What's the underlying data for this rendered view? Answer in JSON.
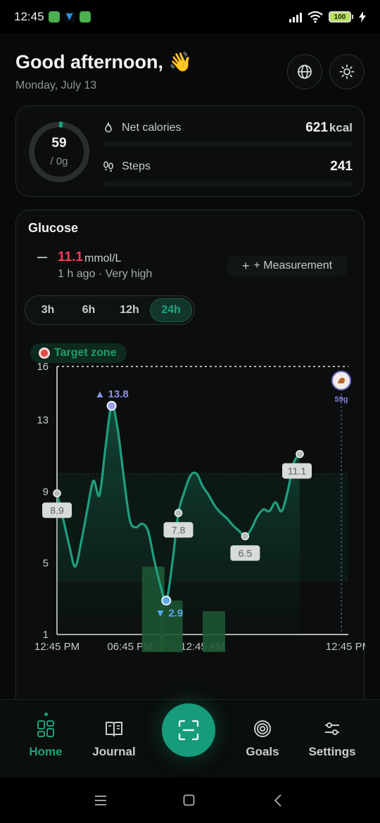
{
  "status_bar": {
    "time": "12:45",
    "battery": "100"
  },
  "header": {
    "greeting": "Good afternoon, 👋",
    "date": "Monday, July 13"
  },
  "summary": {
    "ring_value": "59",
    "ring_goal": "/ 0g",
    "net_calories_label": "Net calories",
    "net_calories_value": "621",
    "net_calories_unit": "kcal",
    "steps_label": "Steps",
    "steps_value": "241"
  },
  "glucose": {
    "title": "Glucose",
    "current_value": "11.1",
    "unit": "mmol/L",
    "subtitle": "1 h ago · Very high",
    "measurement_button": "+ Measurement",
    "ranges": [
      "3h",
      "6h",
      "12h",
      "24h"
    ],
    "active_range": "24h",
    "target_zone_label": "Target zone",
    "meal_label": "59g",
    "colors": {
      "line": "#1f9e7e",
      "high": "#ff3b5c",
      "accent": "#17a27e"
    }
  },
  "chart_data": {
    "type": "line",
    "y_ticks": [
      "16",
      "13",
      "9",
      "5",
      "1"
    ],
    "ylim": [
      1,
      16
    ],
    "x_ticks": [
      "12:45 PM",
      "06:45 PM",
      "12:45 AM",
      "12:45 PM"
    ],
    "xlim_hours": [
      0,
      24
    ],
    "series": [
      {
        "x_hours": [
          0,
          0.5,
          1,
          1.5,
          2,
          2.5,
          3,
          3.5,
          4,
          4.5,
          5,
          5.5,
          6,
          6.5,
          7,
          7.5,
          8,
          8.5,
          9,
          9.5,
          10,
          10.5,
          11,
          11.5,
          12,
          12.5,
          13,
          13.5,
          14,
          14.5,
          15,
          15.5,
          16,
          16.5,
          17,
          17.5,
          18,
          18.5,
          19,
          19.5,
          20,
          20.5,
          21,
          21.5,
          22,
          22.5,
          23,
          23.5
        ],
        "y": [
          8.9,
          7.5,
          6.0,
          4.8,
          6.2,
          8.0,
          9.6,
          8.8,
          11.5,
          13.8,
          12.5,
          9.8,
          7.4,
          7.0,
          7.2,
          6.8,
          5.2,
          3.8,
          2.9,
          5.0,
          7.8,
          9.0,
          9.9,
          10.0,
          9.3,
          8.8,
          8.2,
          7.8,
          7.5,
          7.1,
          6.8,
          6.5,
          6.9,
          7.6,
          8.0,
          7.9,
          8.4,
          7.9,
          9.0,
          10.6,
          11.1
        ]
      }
    ],
    "labeled_points": [
      {
        "label": "8.9",
        "x_hours": 0,
        "y": 8.9
      },
      {
        "label": "13.8",
        "x_hours": 4.5,
        "y": 13.8
      },
      {
        "label": "2.9",
        "x_hours": 9,
        "y": 2.9
      },
      {
        "label": "7.8",
        "x_hours": 10,
        "y": 7.8
      },
      {
        "label": "6.5",
        "x_hours": 15.5,
        "y": 6.5
      },
      {
        "label": "11.1",
        "x_hours": 20,
        "y": 11.1
      }
    ],
    "bars": [
      {
        "x_hours": 7,
        "height": 3.8
      },
      {
        "x_hours": 8.5,
        "height": 1.9
      },
      {
        "x_hours": 12,
        "height": 1.3
      }
    ],
    "target_zone": [
      4,
      10
    ],
    "high_line": 16
  },
  "bottom_nav": {
    "items": [
      {
        "label": "Home",
        "icon": "home-grid-icon"
      },
      {
        "label": "Journal",
        "icon": "journal-book-icon"
      },
      {
        "label": "Goals",
        "icon": "target-icon"
      },
      {
        "label": "Settings",
        "icon": "sliders-icon"
      }
    ],
    "fab_icon": "scan-icon"
  }
}
